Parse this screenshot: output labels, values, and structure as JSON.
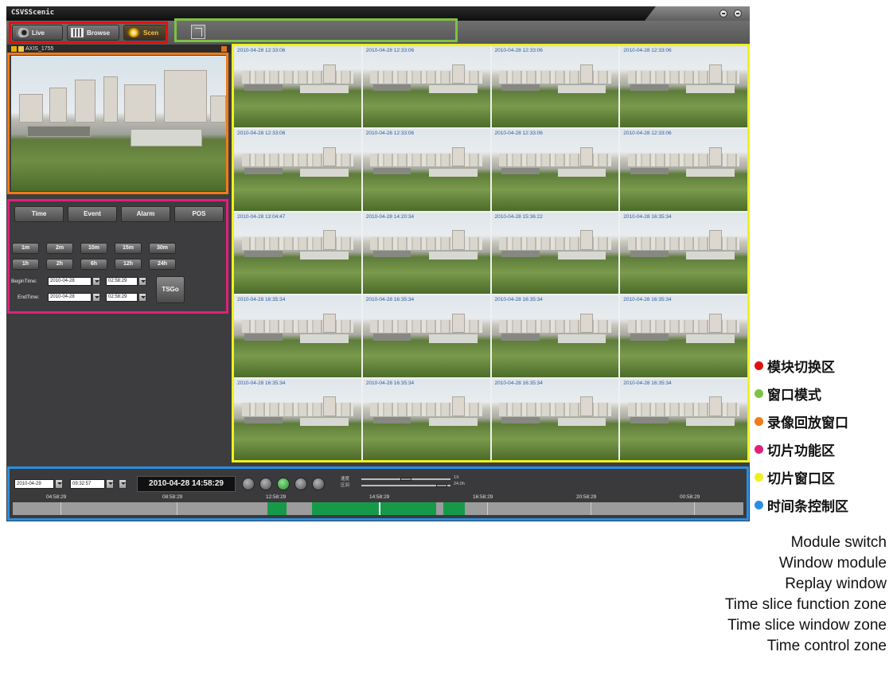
{
  "window": {
    "title": "CSVSScenic"
  },
  "toolbar": {
    "modules": [
      {
        "label": "Live",
        "icon": "camera-icon"
      },
      {
        "label": "Browse",
        "icon": "browse-icon"
      },
      {
        "label": "Scen",
        "icon": "scene-icon"
      }
    ]
  },
  "replay_panel": {
    "camera_label": "AXIS_1755"
  },
  "slice_functions": {
    "tabs": [
      "Time",
      "Event",
      "Alarm",
      "POS"
    ],
    "durations_row1": [
      "1m",
      "2m",
      "10m",
      "15m",
      "30m"
    ],
    "durations_row2": [
      "1h",
      "2h",
      "6h",
      "12h",
      "24h"
    ],
    "begin": {
      "label": "BeginTime:",
      "date": "2010-04-28",
      "time": "02:58:29"
    },
    "end": {
      "label": "EndTime:",
      "date": "2010-04-28",
      "time": "02:58:29"
    },
    "go_label": "TSGo"
  },
  "slices": [
    "2010-04-28 12:33:06",
    "2010-04-28 12:33:06",
    "2010-04-28 12:33:06",
    "2010-04-28 12:33:06",
    "2010-04-28 12:33:06",
    "2010-04-28 12:33:06",
    "2010-04-28 12:33:06",
    "2010-04-28 12:33:06",
    "2010-04-28 13:04:47",
    "2010-04-28 14:20:34",
    "2010-04-28 15:36:22",
    "2010-04-28 16:35:34",
    "2010-04-28 16:35:34",
    "2010-04-28 16:35:34",
    "2010-04-28 16:35:34",
    "2010-04-28 16:35:34",
    "2010-04-28 16:35:34",
    "2010-04-28 16:35:34",
    "2010-04-28 16:35:34",
    "2010-04-28 16:35:34"
  ],
  "time_control": {
    "date": "2010-04-29",
    "time": "09:32:57",
    "current_time": "2010-04-28 14:58:29",
    "speed_label": "速度",
    "speed_value": "1X",
    "span_label": "区间",
    "span_value": "24.0h",
    "tick_labels": [
      "04:58:29",
      "08:58:29",
      "12:58:29",
      "14:58:29",
      "16:58:29",
      "20:58:29",
      "00:58:29"
    ],
    "recorded_segments": [
      [
        0.349,
        0.375
      ],
      [
        0.41,
        0.58
      ],
      [
        0.589,
        0.619
      ]
    ],
    "playhead_fraction": 0.501,
    "recorded_color": "#169a4a"
  },
  "legend": [
    {
      "text": "模块切换区",
      "color": "#e01010"
    },
    {
      "text": "窗口模式",
      "color": "#7dc242"
    },
    {
      "text": "录像回放窗口",
      "color": "#f07b17"
    },
    {
      "text": "切片功能区",
      "color": "#e0207a"
    },
    {
      "text": "切片窗口区",
      "color": "#f0f020"
    },
    {
      "text": "时间条控制区",
      "color": "#2a8ee0"
    }
  ],
  "captions": [
    "Module switch",
    "Window module",
    "Replay window",
    "Time slice function zone",
    "Time slice window zone",
    "Time control zone"
  ]
}
